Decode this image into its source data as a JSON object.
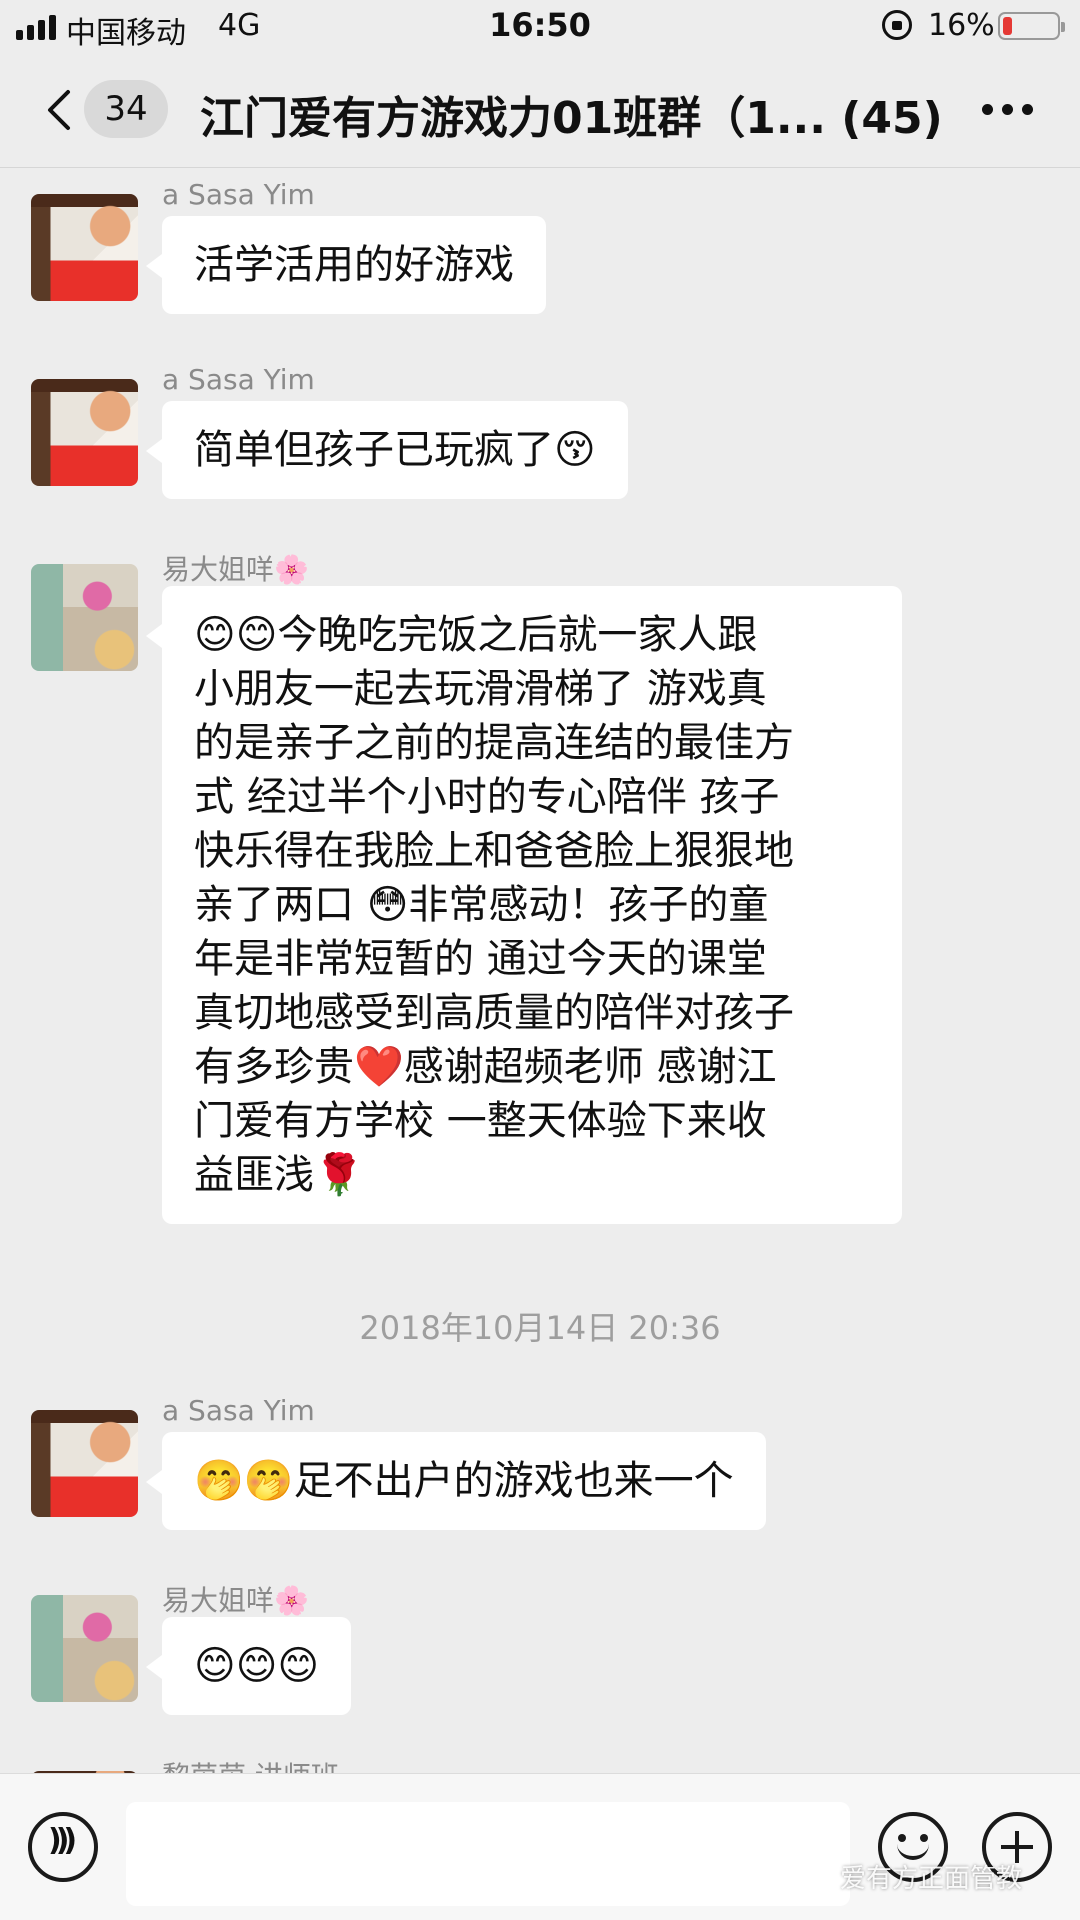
{
  "status_bar": {
    "carrier": "中国移动",
    "network": "4G",
    "time": "16:50",
    "battery_percent_text": "16%",
    "battery_level": 0.16,
    "battery_color": "#e53935"
  },
  "nav": {
    "unread_count": "34",
    "title": "江门爱有方游戏力01班群（1... (45)",
    "icons": [
      "chevron-left-icon",
      "more-icon"
    ]
  },
  "messages": [
    {
      "sender": "a Sasa Yim",
      "text": "活学活用的好游戏"
    },
    {
      "sender": "a Sasa Yim",
      "text": "简单但孩子已玩疯了😚"
    },
    {
      "sender": "易大姐咩🌸",
      "lines": [
        "😊😊今晚吃完饭之后就一家人跟",
        "小朋友一起去玩滑滑梯了 游戏真",
        "的是亲子之前的提高连结的最佳方",
        "式 经过半个小时的专心陪伴 孩子",
        "快乐得在我脸上和爸爸脸上狠狠地",
        "亲了两口 😳非常感动！孩子的童",
        "年是非常短暂的 通过今天的课堂",
        "真切地感受到高质量的陪伴对孩子",
        "有多珍贵❤️感谢超频老师 感谢江",
        "门爱有方学校 一整天体验下来收",
        "益匪浅🌹"
      ]
    },
    {
      "timestamp": "2018年10月14日 20:36"
    },
    {
      "sender": "a Sasa Yim",
      "text": "🤭🤭足不出户的游戏也来一个"
    },
    {
      "sender": "易大姐咩🌸",
      "text": "😊😊😊"
    },
    {
      "sender": "黎茵茵 讲师班"
    }
  ],
  "input_bar": {
    "icons": [
      "voice-icon",
      "emoji-icon",
      "plus-icon"
    ],
    "input_value": ""
  },
  "watermark": "爱有方正面管教"
}
